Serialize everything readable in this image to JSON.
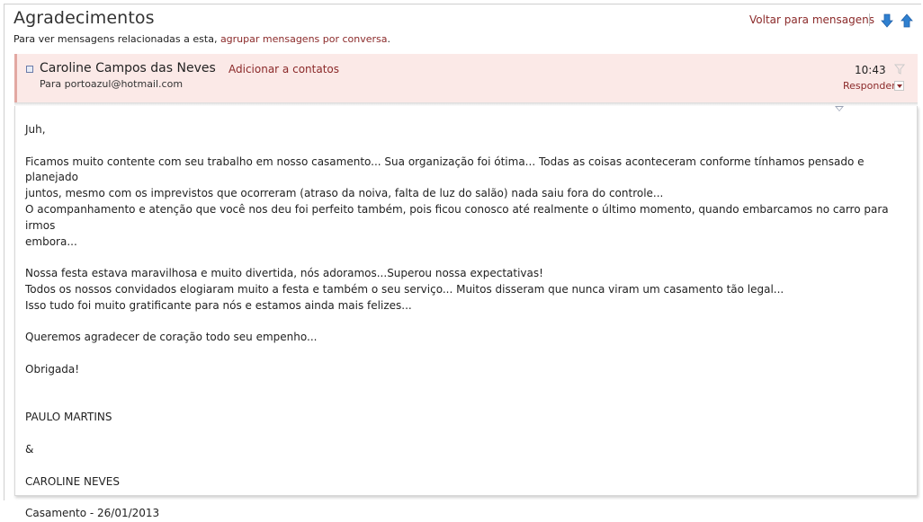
{
  "header": {
    "title": "Agradecimentos",
    "related_text": "Para ver mensagens relacionadas a esta, ",
    "related_link": "agrupar mensagens por conversa",
    "related_suffix": ".",
    "back_link": "Voltar para mensagens",
    "next_icon": "arrow-down-icon",
    "prev_icon": "arrow-up-icon",
    "arrow_color": "#2f80d0"
  },
  "message": {
    "sender": "Caroline Campos das Neves",
    "add_contact": "Adicionar a contatos",
    "to": "Para portoazul@hotmail.com",
    "time": "10:43",
    "reply": "Responder",
    "header_bg": "#fbe9e7",
    "accent": "#8b2a2a"
  },
  "body": {
    "greeting": "Juh,",
    "p1_l1": "Ficamos muito contente com seu trabalho em nosso casamento... Sua organização foi ótima... Todas as coisas aconteceram conforme tínhamos pensado e planejado",
    "p1_l2": "juntos, mesmo com os imprevistos que ocorreram (atraso da noiva, falta de luz do salão) nada saiu fora do controle...",
    "p1_l3": "O acompanhamento e atenção que você nos deu foi perfeito também, pois ficou conosco até realmente o último momento, quando embarcamos no carro para irmos",
    "p1_l4": "embora...",
    "p2_l1": "Nossa festa estava maravilhosa e muito divertida, nós adoramos...Superou nossa expectativas!",
    "p2_l2": "Todos os nossos convidados elogiaram muito a festa e também o seu serviço... Muitos disseram que nunca viram um casamento tão legal...",
    "p2_l3": "Isso tudo foi muito gratificante para nós e estamos ainda mais felizes...",
    "p3": "Queremos agradecer de coração todo seu empenho...",
    "thanks": "Obrigada!",
    "sig1": "PAULO MARTINS",
    "amp": "&",
    "sig2": "CAROLINE NEVES",
    "event": "Casamento - 26/01/2013"
  }
}
